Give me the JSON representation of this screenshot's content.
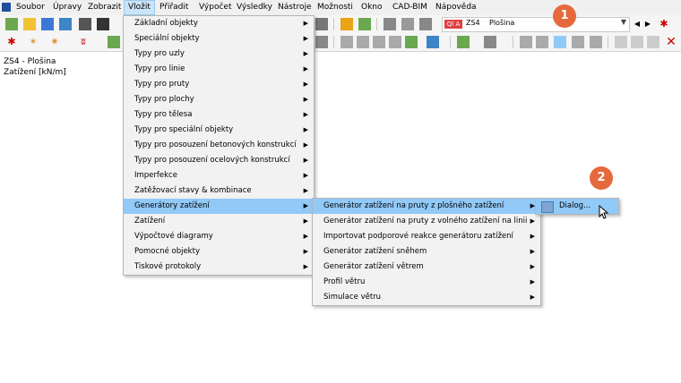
{
  "menubar": {
    "items": [
      "Soubor",
      "Úpravy",
      "Zobrazit",
      "Vložit",
      "Přiřadit",
      "Výpočet",
      "Výsledky",
      "Nástroje",
      "Možnosti",
      "Okno",
      "CAD-BIM",
      "Nápověda"
    ]
  },
  "load_case": {
    "badge": "Ql A",
    "id": "ZS4",
    "name": "Plošina"
  },
  "info": {
    "line1": "ZS4 - Plošina",
    "line2": "Zatížení [kN/m]"
  },
  "menu_insert": {
    "items": [
      "Základní objekty",
      "Speciální objekty",
      "Typy pro uzly",
      "Typy pro linie",
      "Typy pro pruty",
      "Typy pro plochy",
      "Typy pro tělesa",
      "Typy pro speciální objekty",
      "Typy pro posouzení betonových konstrukcí",
      "Typy pro posouzení ocelových konstrukcí",
      "Imperfekce",
      "Zatěžovací stavy & kombinace",
      "Generátory zatížení",
      "Zatížení",
      "Výpočtové diagramy",
      "Pomocné objekty",
      "Tiskové protokoly"
    ]
  },
  "menu_generators": {
    "items": [
      "Generátor zatížení na pruty z plošného zatížení",
      "Generátor zatížení na pruty z volného zatížení na linii",
      "Importovat podporové reakce generátoru zatížení",
      "Generátor zatížení sněhem",
      "Generátor zatížení větrem",
      "Profil větru",
      "Simulace větru"
    ]
  },
  "menu_dialog": {
    "label": "Dialog..."
  },
  "callouts": {
    "one": "1",
    "two": "2"
  },
  "colors": {
    "accent": "#e5693c",
    "selection": "#91c9f7",
    "menu_active": "#cce4f7"
  }
}
